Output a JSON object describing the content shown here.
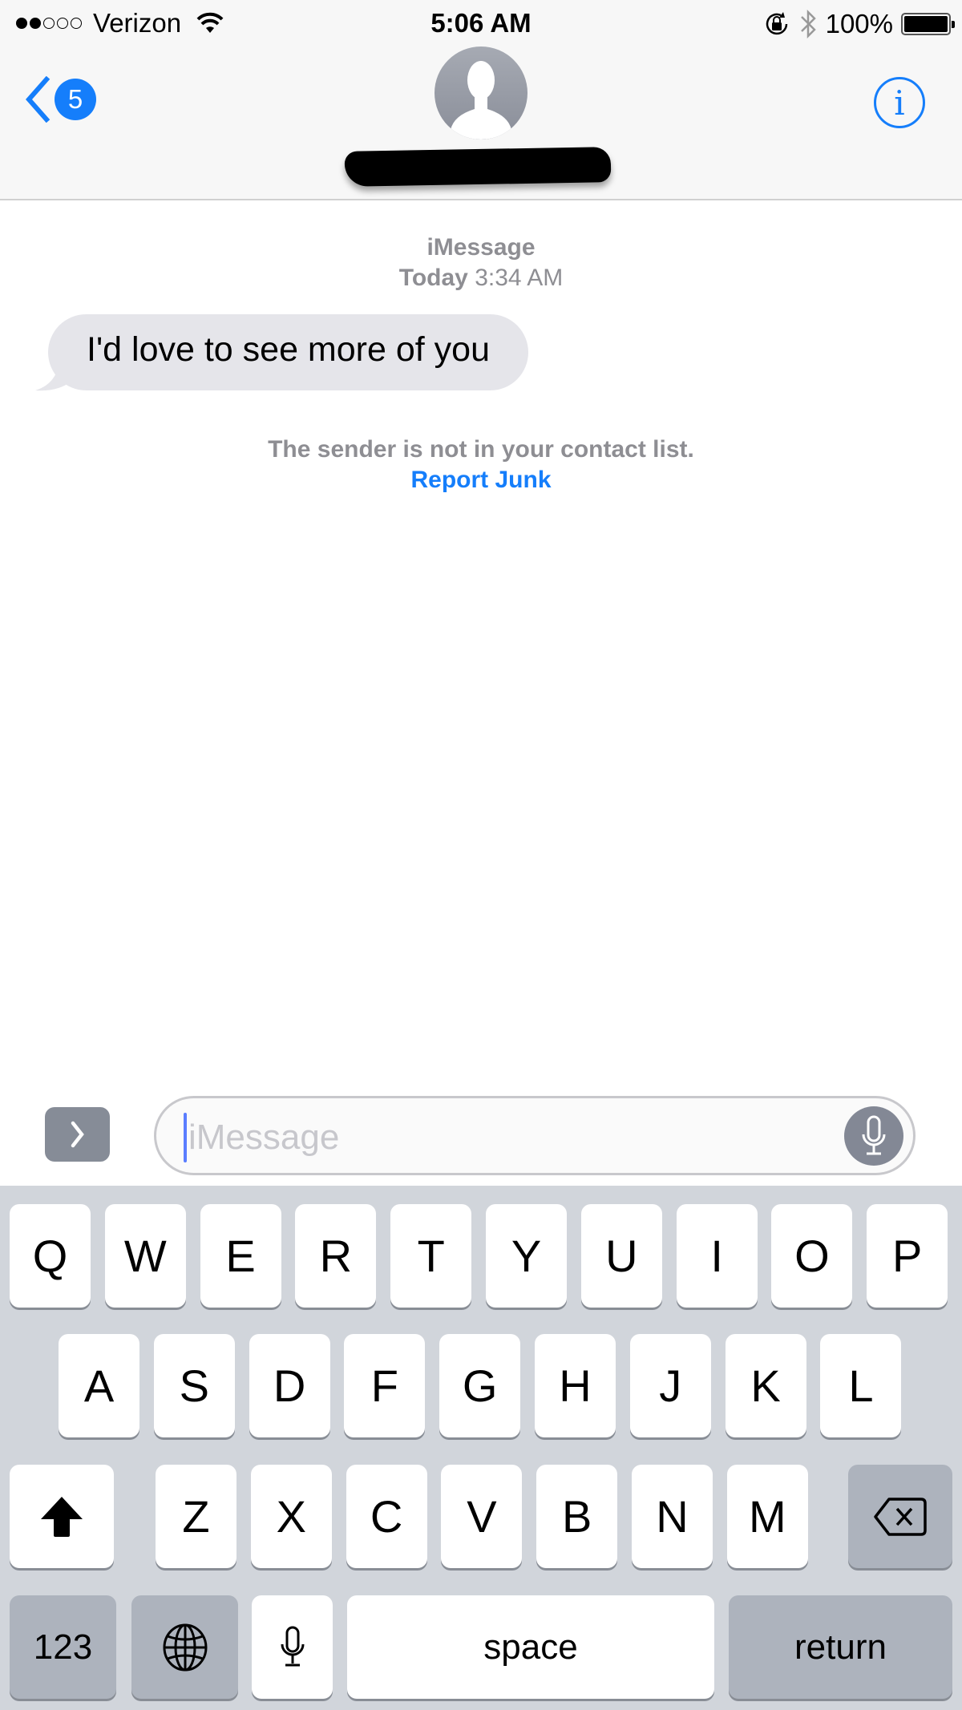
{
  "status_bar": {
    "signal_bars_filled": 2,
    "signal_bars_total": 5,
    "carrier": "Verizon",
    "time": "5:06 AM",
    "battery_percent": "100%",
    "icons": [
      "wifi-icon",
      "orientation-lock-icon",
      "bluetooth-icon",
      "battery-icon"
    ]
  },
  "nav": {
    "back_badge_count": "5",
    "contact_name": "[redacted]",
    "info_label": "i"
  },
  "conversation": {
    "service": "iMessage",
    "day": "Today",
    "timestamp": "3:34 AM",
    "messages": [
      {
        "direction": "incoming",
        "text": "I'd love to see more of you"
      }
    ],
    "notice_text": "The sender is not in your contact list.",
    "report_link": "Report Junk"
  },
  "compose": {
    "placeholder": "iMessage",
    "value": ""
  },
  "keyboard": {
    "row1": [
      "Q",
      "W",
      "E",
      "R",
      "T",
      "Y",
      "U",
      "I",
      "O",
      "P"
    ],
    "row2": [
      "A",
      "S",
      "D",
      "F",
      "G",
      "H",
      "J",
      "K",
      "L"
    ],
    "row3": [
      "Z",
      "X",
      "C",
      "V",
      "B",
      "N",
      "M"
    ],
    "numbers_label": "123",
    "space_label": "space",
    "return_label": "return"
  },
  "colors": {
    "accent": "#157efb",
    "incoming_bubble": "#e5e5ea",
    "meta_text": "#8e8e93",
    "keyboard_bg": "#d1d5db",
    "function_key": "#adb3bd"
  }
}
